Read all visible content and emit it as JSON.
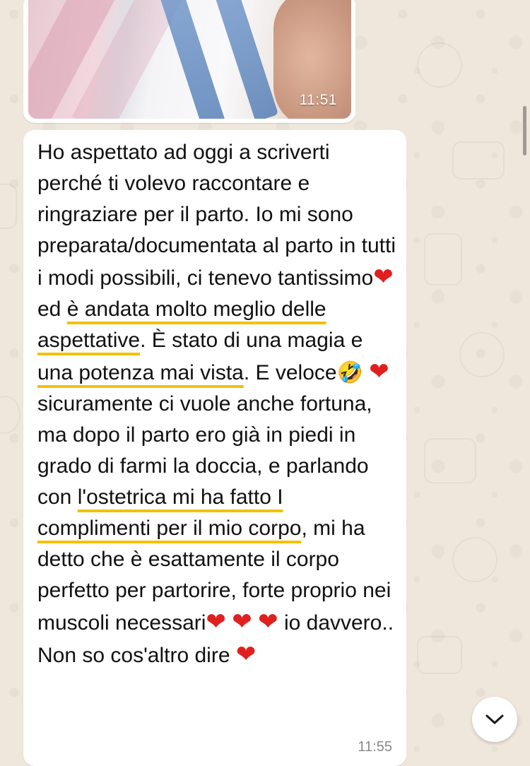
{
  "colors": {
    "wallpaper": "#efe7dc",
    "bubble": "#ffffff",
    "highlight": "#f2c200",
    "heart": "#e02020",
    "time": "#8a8a8a"
  },
  "photo_message": {
    "time": "11:51"
  },
  "text_message": {
    "time": "11:55",
    "segments": {
      "s1": "Ho aspettato ad oggi a scriverti perché ti volevo raccontare e ringraziare per il parto. Io mi sono preparata/documentata al parto in tutti i modi possibili, ci tenevo tantissimo",
      "s2": "ed ",
      "s3": "è andata molto meglio delle aspettative",
      "s4": ". È stato di una magia e ",
      "s5": "una potenza mai vista",
      "s6": ". E veloce",
      "s7": "sicuramente ci vuole anche fortuna, ma dopo il parto ero già in piedi in grado di farmi la doccia, e parlando con ",
      "s8": "l'ostetrica mi ha fatto I complimenti per il mio corpo",
      "s9": ", mi ha detto che è esattamente il corpo perfetto per partorire, forte proprio nei muscoli necessari",
      "s10": " io davvero.. Non so cos'altro dire"
    },
    "emoji": {
      "heart": "❤",
      "laugh": "🤣"
    }
  },
  "icons": {
    "scroll_down": "chevron-down-icon"
  }
}
